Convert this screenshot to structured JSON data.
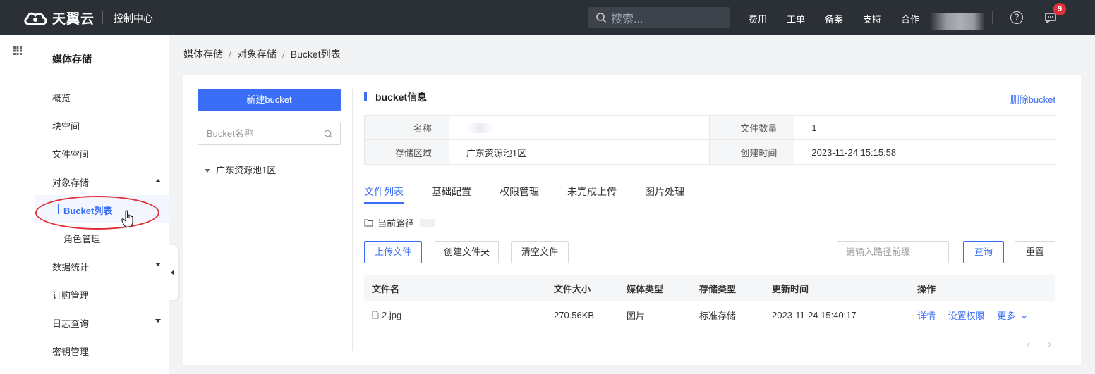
{
  "topbar": {
    "logo_text": "天翼云",
    "console_label": "控制中心",
    "search_placeholder": "搜索...",
    "nav": [
      "费用",
      "工单",
      "备案",
      "支持",
      "合作"
    ],
    "notification_count": "9"
  },
  "sidebar": {
    "title": "媒体存储",
    "items": {
      "overview": "概览",
      "block": "块空间",
      "file": "文件空间",
      "object": "对象存储",
      "bucket_list": "Bucket列表",
      "role": "角色管理",
      "stats": "数据统计",
      "orders": "订购管理",
      "logs": "日志查询",
      "keys": "密钥管理"
    }
  },
  "breadcrumb": [
    "媒体存储",
    "对象存储",
    "Bucket列表"
  ],
  "left_panel": {
    "new_bucket_label": "新建bucket",
    "bucket_search_placeholder": "Bucket名称",
    "tree_node": "广东资源池1区"
  },
  "bucket_info": {
    "title": "bucket信息",
    "delete_label": "删除bucket",
    "labels": {
      "name": "名称",
      "file_count": "文件数量",
      "region": "存储区域",
      "created": "创建时间"
    },
    "values": {
      "file_count": "1",
      "region": "广东资源池1区",
      "created": "2023-11-24 15:15:58"
    }
  },
  "tabs": [
    "文件列表",
    "基础配置",
    "权限管理",
    "未完成上传",
    "图片处理"
  ],
  "path_label": "当前路径",
  "actions": {
    "upload": "上传文件",
    "create_folder": "创建文件夹",
    "clear": "清空文件",
    "prefix_placeholder": "请输入路径前缀",
    "query": "查询",
    "reset": "重置"
  },
  "file_table": {
    "headers": [
      "文件名",
      "文件大小",
      "媒体类型",
      "存储类型",
      "更新时间",
      "操作"
    ],
    "rows": [
      {
        "name": "2.jpg",
        "size": "270.56KB",
        "media_type": "图片",
        "storage_type": "标准存储",
        "updated": "2023-11-24 15:40:17",
        "ops": [
          "详情",
          "设置权限",
          "更多"
        ]
      }
    ]
  },
  "colors": {
    "accent": "#3a6ef6",
    "topbar": "#2b2f36",
    "badge": "#e5303b",
    "annotation": "#e02f35"
  }
}
